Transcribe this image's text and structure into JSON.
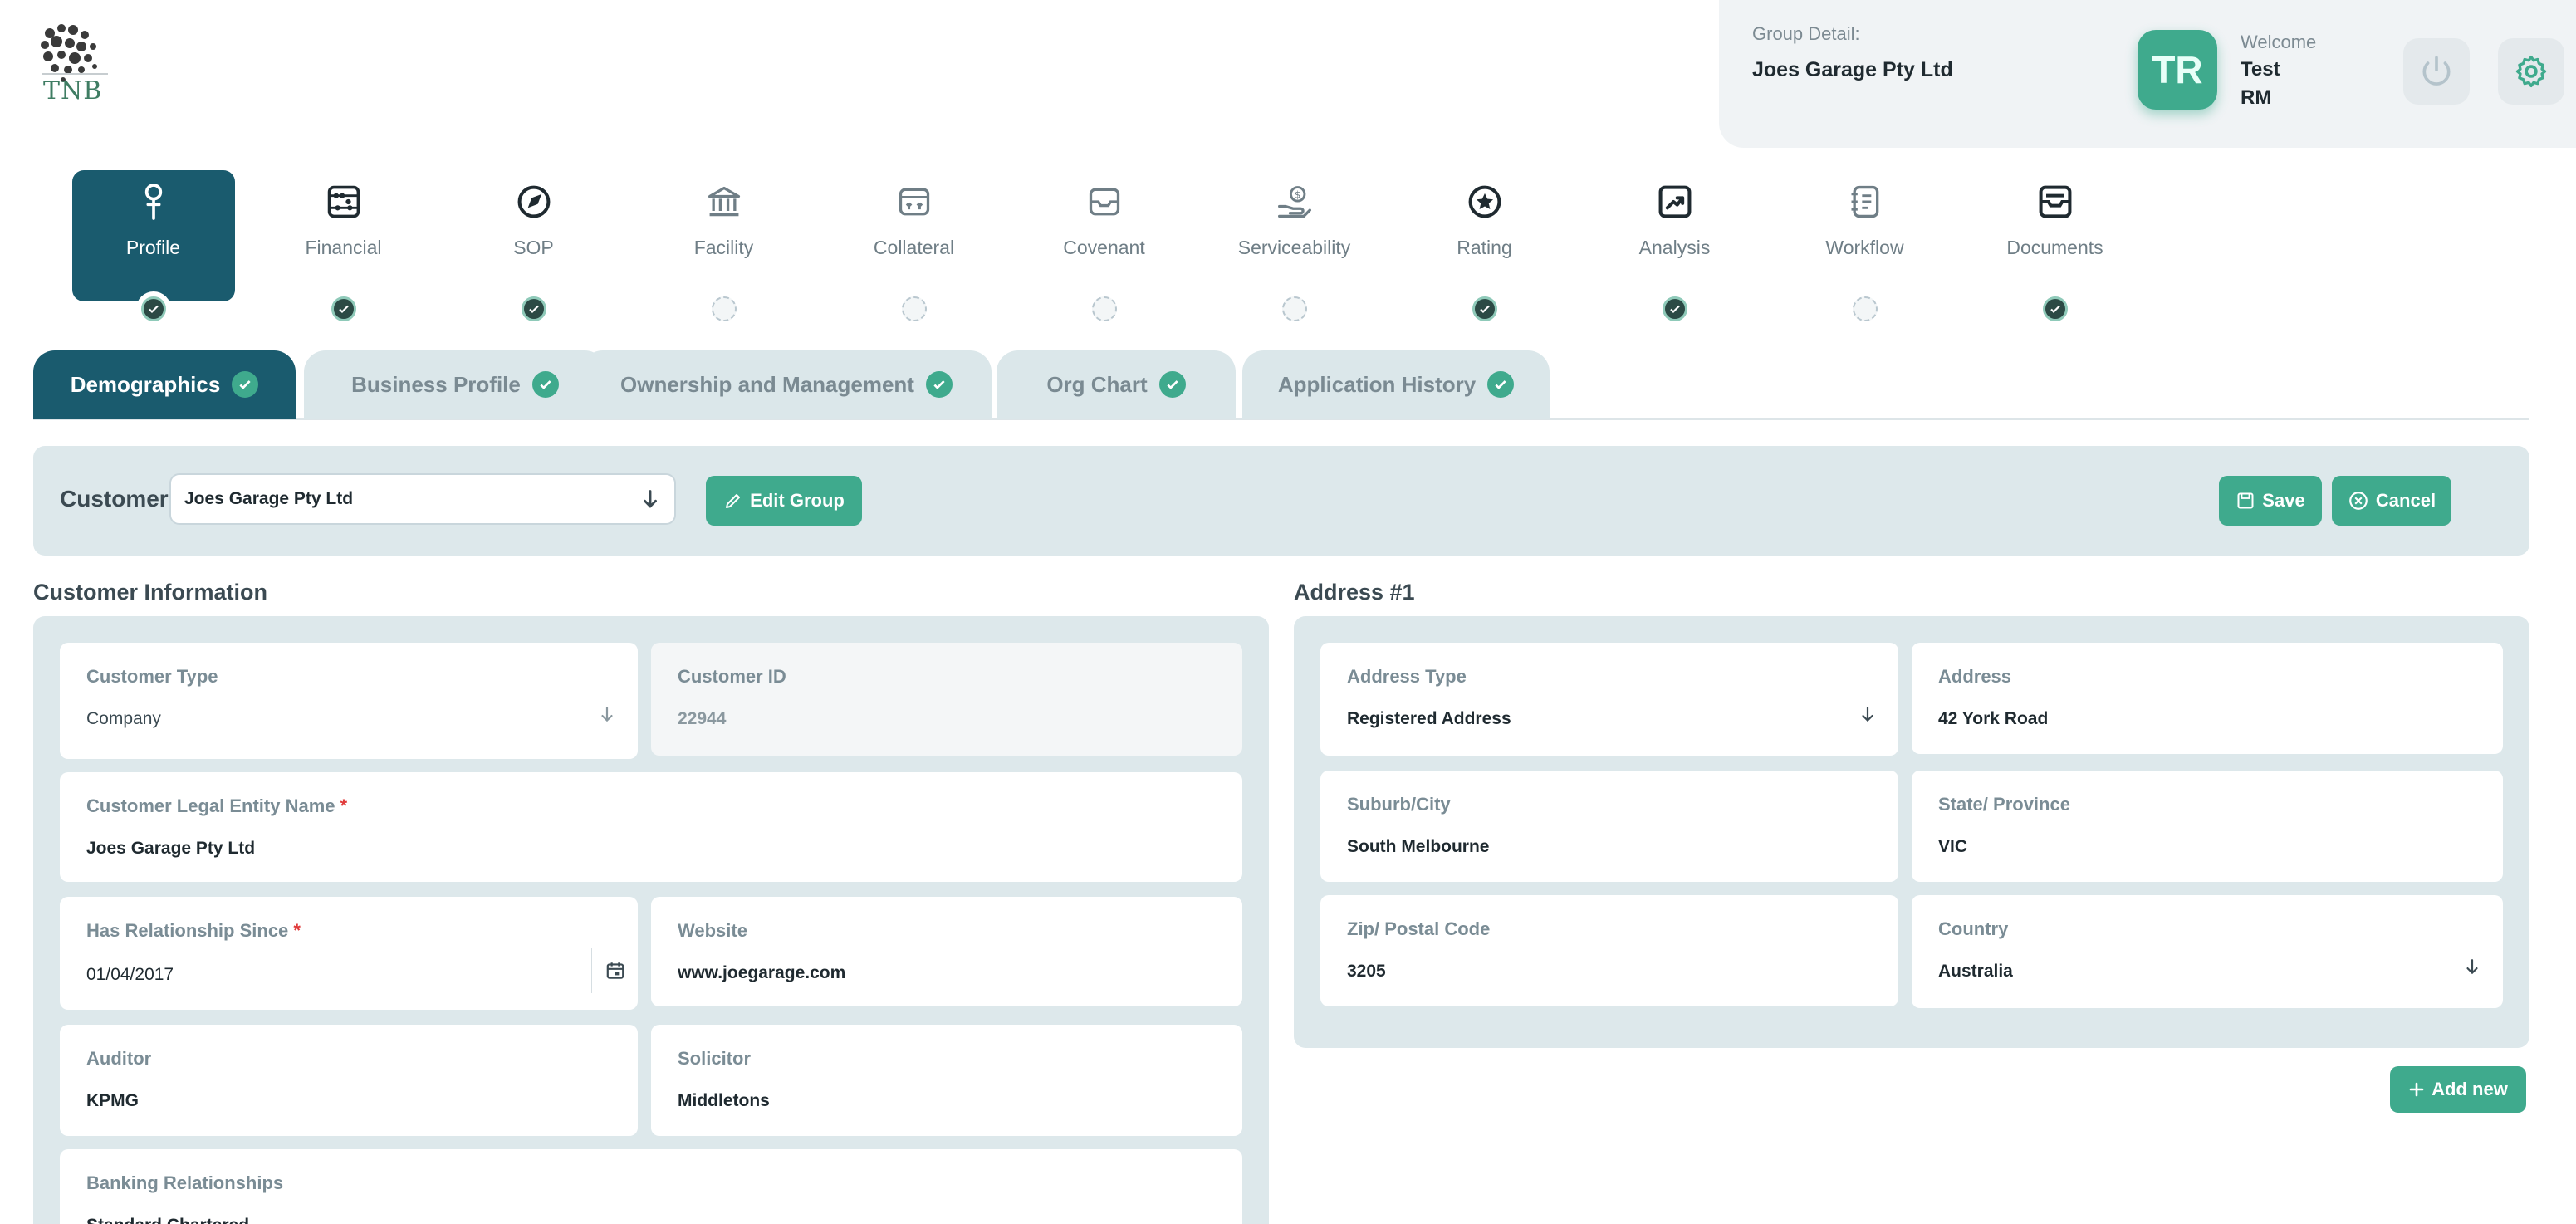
{
  "brand": {
    "logo_text": "TNB"
  },
  "header": {
    "group_label": "Group Detail:",
    "group_name": "Joes Garage Pty Ltd",
    "avatar_initials": "TR",
    "welcome_label": "Welcome",
    "user_name": "Test",
    "user_role": "RM"
  },
  "steps": [
    {
      "label": "Profile",
      "icon": "person-pin-icon",
      "status": "done",
      "active": true
    },
    {
      "label": "Financial",
      "icon": "abacus-icon",
      "status": "done"
    },
    {
      "label": "SOP",
      "icon": "compass-icon",
      "status": "done"
    },
    {
      "label": "Facility",
      "icon": "bank-icon",
      "status": "pending"
    },
    {
      "label": "Collateral",
      "icon": "archive-box-icon",
      "status": "pending"
    },
    {
      "label": "Covenant",
      "icon": "inbox-icon",
      "status": "pending"
    },
    {
      "label": "Serviceability",
      "icon": "hand-coin-icon",
      "status": "pending"
    },
    {
      "label": "Rating",
      "icon": "star-badge-icon",
      "status": "done"
    },
    {
      "label": "Analysis",
      "icon": "trend-chart-icon",
      "status": "done"
    },
    {
      "label": "Workflow",
      "icon": "notebook-icon",
      "status": "pending"
    },
    {
      "label": "Documents",
      "icon": "document-stack-icon",
      "status": "done"
    }
  ],
  "tabs": [
    {
      "label": "Demographics",
      "active": true
    },
    {
      "label": "Business Profile"
    },
    {
      "label": "Ownership and Management"
    },
    {
      "label": "Org Chart"
    },
    {
      "label": "Application History"
    }
  ],
  "customer_bar": {
    "label": "Customer",
    "selected": "Joes Garage Pty Ltd",
    "edit_group": "Edit Group",
    "save": "Save",
    "cancel": "Cancel"
  },
  "customer_info": {
    "title": "Customer Information",
    "customer_type": {
      "label": "Customer Type",
      "value": "Company"
    },
    "customer_id": {
      "label": "Customer ID",
      "value": "22944"
    },
    "legal_name": {
      "label": "Customer Legal Entity Name",
      "value": "Joes Garage Pty Ltd"
    },
    "relationship_since": {
      "label": "Has Relationship Since",
      "value": "01/04/2017"
    },
    "website": {
      "label": "Website",
      "value": "www.joegarage.com"
    },
    "auditor": {
      "label": "Auditor",
      "value": "KPMG"
    },
    "solicitor": {
      "label": "Solicitor",
      "value": "Middletons"
    },
    "banking": {
      "label": "Banking Relationships",
      "value": "Standard Chartered"
    }
  },
  "address": {
    "title": "Address #1",
    "address_type": {
      "label": "Address Type",
      "value": "Registered Address"
    },
    "address": {
      "label": "Address",
      "value": "42 York Road"
    },
    "suburb": {
      "label": "Suburb/City",
      "value": "South Melbourne"
    },
    "state": {
      "label": "State/ Province",
      "value": "VIC"
    },
    "zip": {
      "label": "Zip/ Postal Code",
      "value": "3205"
    },
    "country": {
      "label": "Country",
      "value": "Australia"
    },
    "add_new": "Add new"
  },
  "colors": {
    "primary": "#1a5b6e",
    "accent": "#3faa8d",
    "panel": "#dde8eb",
    "required": "#e03a3a"
  }
}
